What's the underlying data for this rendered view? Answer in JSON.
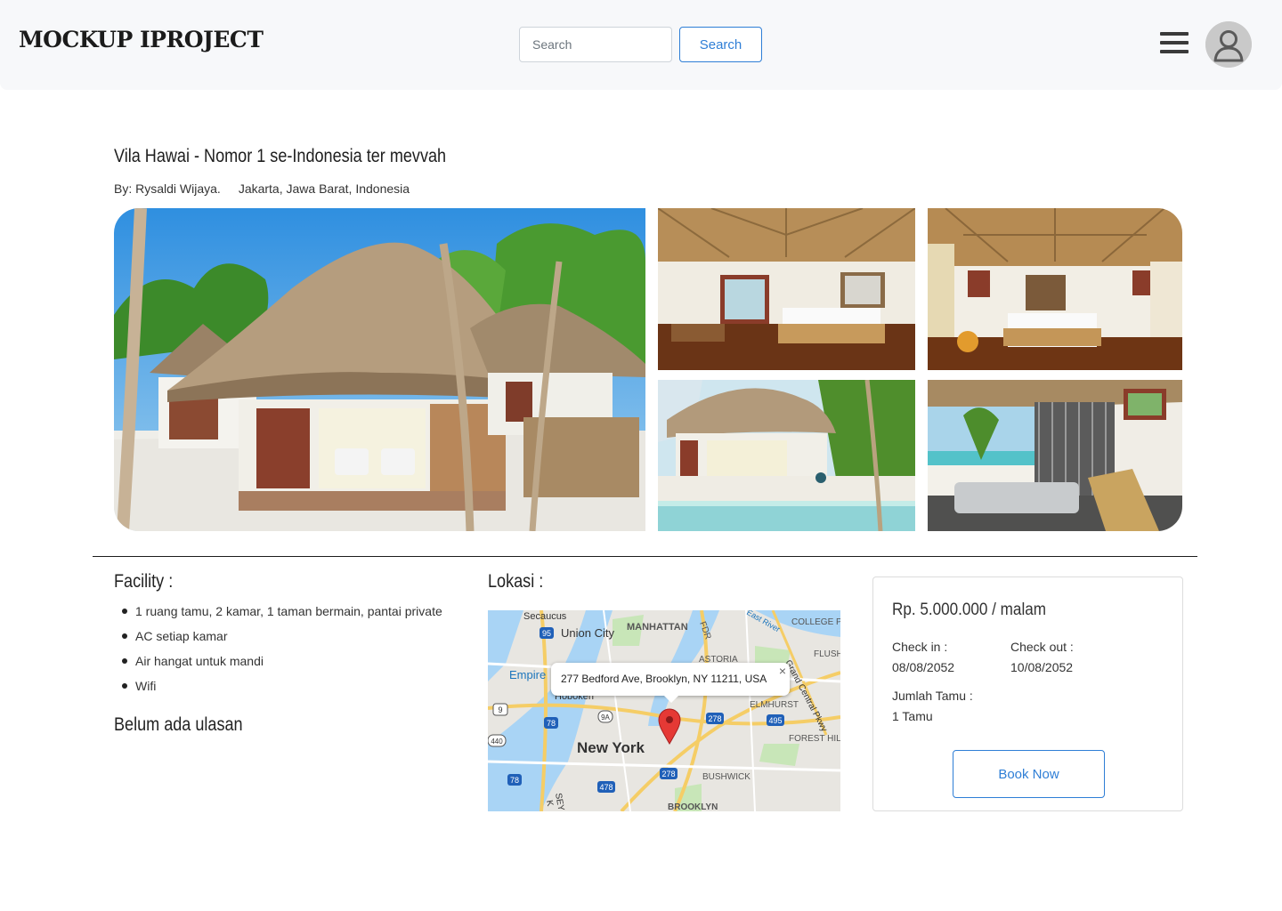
{
  "header": {
    "brand": "MOCKUP IPROJECT",
    "search_placeholder": "Search",
    "search_button": "Search",
    "menu_icon": "hamburger-menu-icon",
    "avatar_icon": "user-avatar-icon"
  },
  "listing": {
    "title": "Vila Hawai - Nomor 1 se-Indonesia ter mevvah",
    "author": "By: Rysaldi Wijaya.",
    "location": "Jakarta, Jawa Barat, Indonesia"
  },
  "facility": {
    "heading": "Facility :",
    "items": [
      "1 ruang tamu, 2 kamar, 1 taman bermain, pantai private",
      "AC setiap kamar",
      "Air hangat untuk mandi",
      "Wifi"
    ],
    "reviews_heading": "Belum ada ulasan"
  },
  "lokasi": {
    "heading": "Lokasi :",
    "address": "277 Bedford Ave, Brooklyn, NY 11211, USA",
    "close_symbol": "×",
    "labels": {
      "secaucus": "Secaucus",
      "union_city": "Union City",
      "manhattan": "MANHATTAN",
      "astoria": "ASTORIA",
      "college_pt": "COLLEGE P",
      "flush": "FLUSH",
      "empire": "Empire",
      "hoboken": "Hoboken",
      "new_york": "New York",
      "elmhurst": "ELMHURST",
      "forest_hill": "FOREST HIL",
      "bushwick": "BUSHWICK",
      "brooklyn": "BROOKLYN",
      "grand_central": "Grand Central Pkwy",
      "fdr": "FDR",
      "east_river": "East River",
      "sey": "SEY",
      "k": "K",
      "r95": "95",
      "r9": "9",
      "r440": "440",
      "r78a": "78",
      "r78b": "78",
      "r9a": "9A",
      "r278a": "278",
      "r278b": "278",
      "r495": "495",
      "r478": "478"
    }
  },
  "booking": {
    "price": "Rp. 5.000.000 / malam",
    "checkin_label": "Check in :",
    "checkin_value": "08/08/2052",
    "checkout_label": "Check out :",
    "checkout_value": "10/08/2052",
    "guests_label": "Jumlah Tamu :",
    "guests_value": "1 Tamu",
    "book_button": "Book Now"
  },
  "colors": {
    "accent": "#2e7ed6",
    "header_bg": "#f7f8fa",
    "map_pin": "#e53935"
  }
}
